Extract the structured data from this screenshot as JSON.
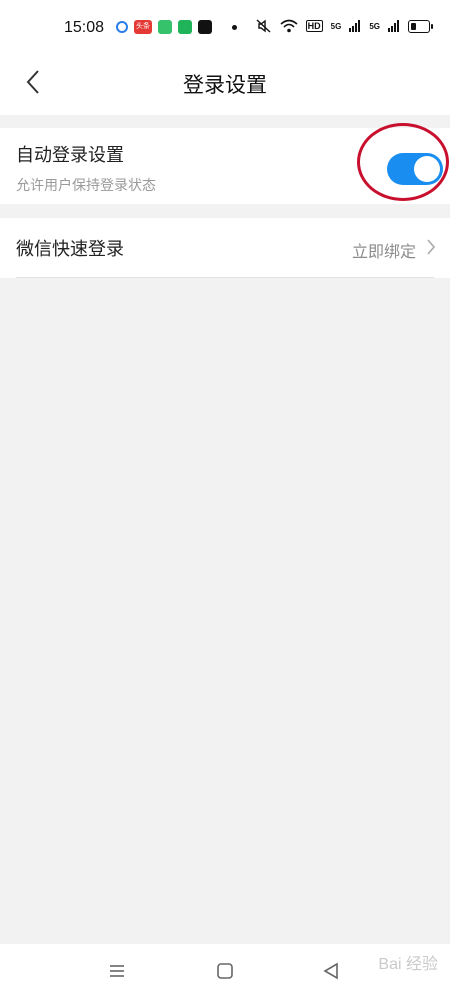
{
  "status_bar": {
    "time": "15:08",
    "notification_icons": [
      "dot-icon",
      "toutiao-icon",
      "gallery-icon",
      "message-icon",
      "o-icon"
    ],
    "toutiao_text": "头条",
    "network_labels": [
      "HD",
      "5G",
      "5G"
    ]
  },
  "header": {
    "title": "登录设置",
    "back_icon": "chevron-left-icon"
  },
  "settings": {
    "auto_login": {
      "title": "自动登录设置",
      "subtitle": "允许用户保持登录状态",
      "enabled": true,
      "toggle_color": "#1a8ef0"
    },
    "wechat_login": {
      "title": "微信快速登录",
      "action_label": "立即绑定"
    }
  },
  "annotation": {
    "color": "#c8102e"
  },
  "system_nav": {
    "icons": [
      "menu-icon",
      "home-square-icon",
      "back-triangle-icon"
    ]
  },
  "watermark": {
    "text": "Bai 经验"
  }
}
